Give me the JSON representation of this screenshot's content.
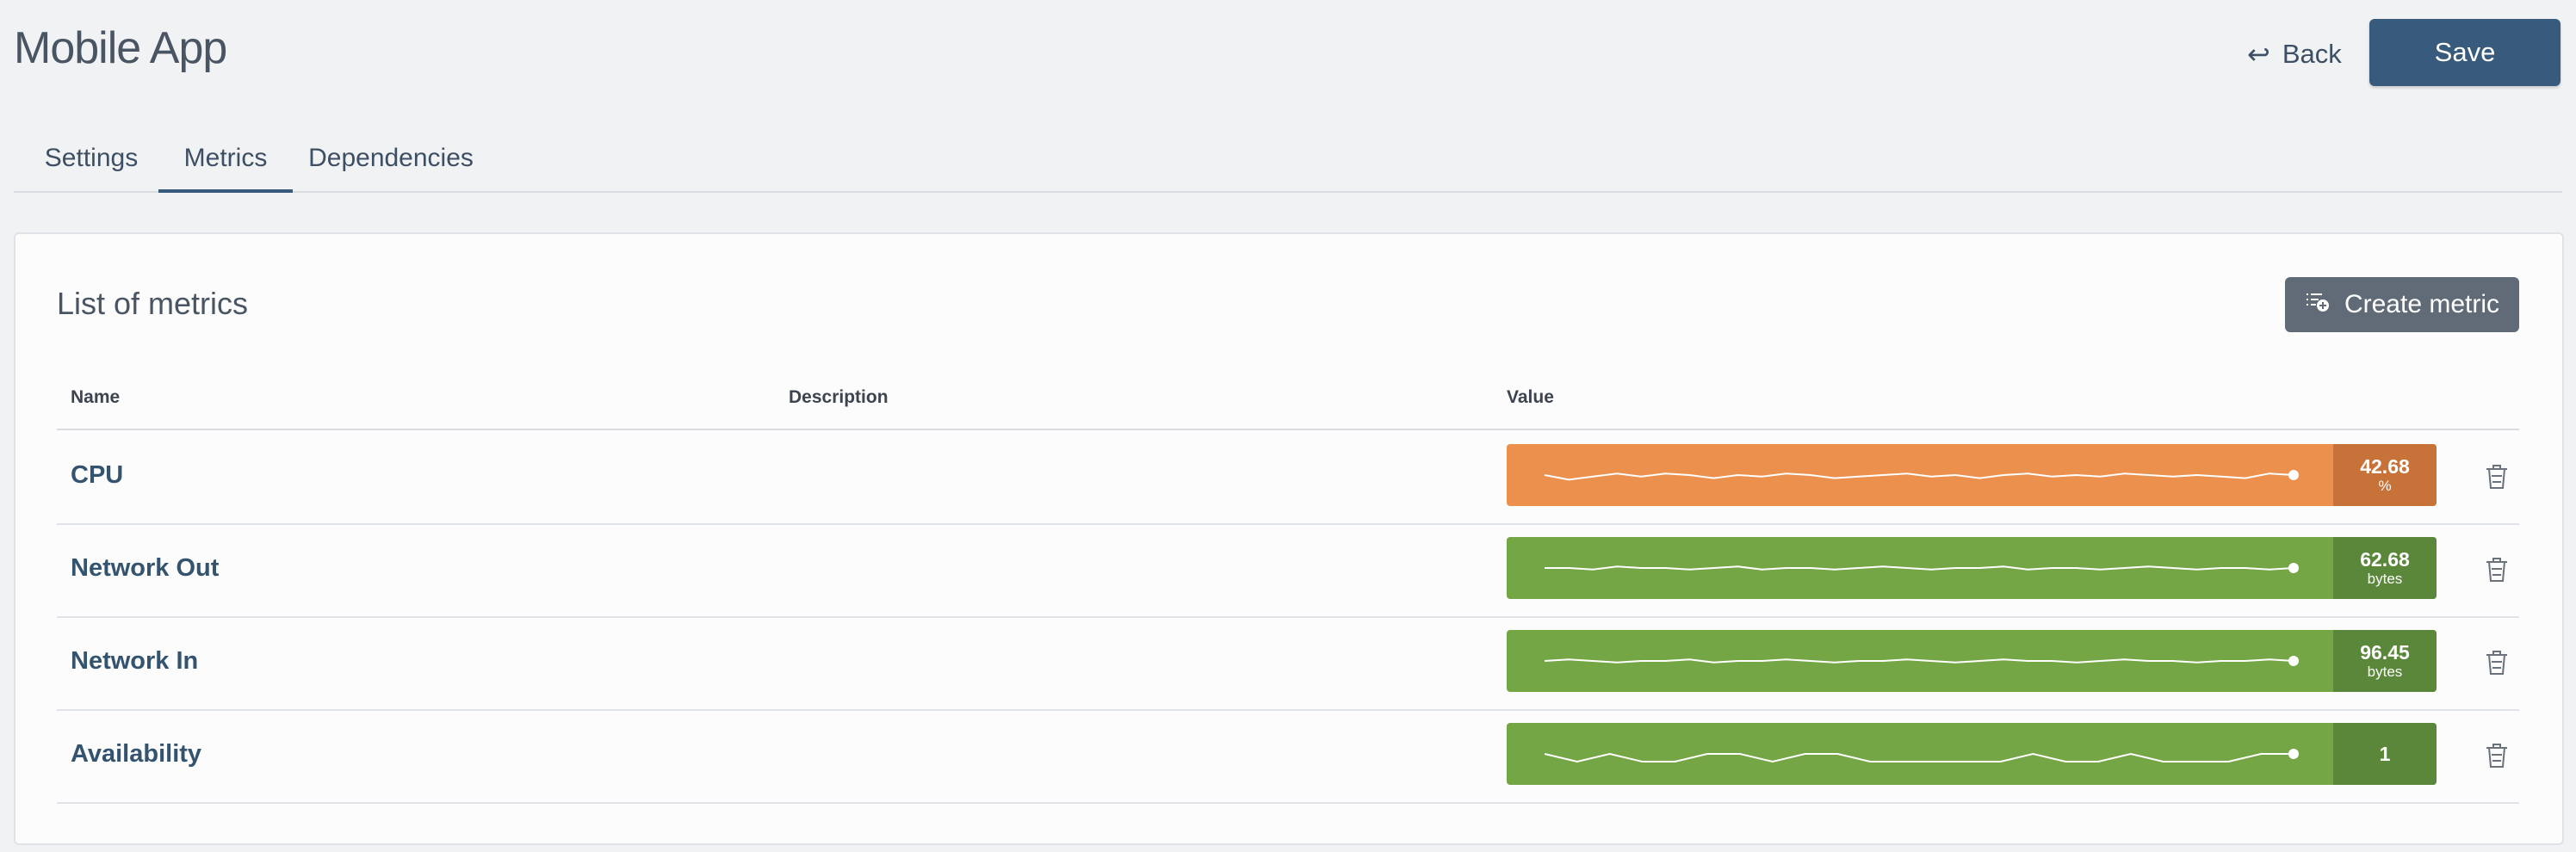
{
  "header": {
    "title": "Mobile App",
    "back_label": "Back",
    "save_label": "Save"
  },
  "tabs": [
    {
      "label": "Settings",
      "active": false
    },
    {
      "label": "Metrics",
      "active": true
    },
    {
      "label": "Dependencies",
      "active": false
    }
  ],
  "card": {
    "title": "List of metrics",
    "create_label": "Create metric"
  },
  "table": {
    "columns": [
      "Name",
      "Description",
      "Value"
    ],
    "rows": [
      {
        "name": "CPU",
        "description": "",
        "value": "42.68",
        "unit": "%",
        "status": "warning",
        "bar_color": "#eb904d",
        "value_color": "#c77238",
        "sparkline": [
          0.5,
          0.35,
          0.45,
          0.55,
          0.45,
          0.55,
          0.5,
          0.4,
          0.5,
          0.45,
          0.55,
          0.5,
          0.4,
          0.45,
          0.5,
          0.55,
          0.45,
          0.5,
          0.4,
          0.5,
          0.55,
          0.45,
          0.5,
          0.45,
          0.55,
          0.5,
          0.45,
          0.5,
          0.45,
          0.4,
          0.55,
          0.5
        ]
      },
      {
        "name": "Network Out",
        "description": "",
        "value": "62.68",
        "unit": "bytes",
        "status": "ok",
        "bar_color": "#74a646",
        "value_color": "#5a8739",
        "sparkline": [
          0.5,
          0.5,
          0.45,
          0.55,
          0.5,
          0.5,
          0.45,
          0.5,
          0.55,
          0.45,
          0.5,
          0.5,
          0.45,
          0.5,
          0.55,
          0.5,
          0.45,
          0.5,
          0.5,
          0.55,
          0.45,
          0.5,
          0.5,
          0.45,
          0.5,
          0.55,
          0.5,
          0.45,
          0.5,
          0.5,
          0.45,
          0.5
        ]
      },
      {
        "name": "Network In",
        "description": "",
        "value": "96.45",
        "unit": "bytes",
        "status": "ok",
        "bar_color": "#74a646",
        "value_color": "#5a8739",
        "sparkline": [
          0.5,
          0.55,
          0.5,
          0.45,
          0.5,
          0.5,
          0.55,
          0.45,
          0.5,
          0.5,
          0.55,
          0.5,
          0.45,
          0.5,
          0.5,
          0.55,
          0.5,
          0.45,
          0.5,
          0.55,
          0.5,
          0.5,
          0.45,
          0.5,
          0.55,
          0.5,
          0.5,
          0.45,
          0.5,
          0.5,
          0.55,
          0.5
        ]
      },
      {
        "name": "Availability",
        "description": "",
        "value": "1",
        "unit": "",
        "status": "ok",
        "bar_color": "#74a646",
        "value_color": "#5a8739",
        "sparkline": [
          0.5,
          0.25,
          0.5,
          0.25,
          0.25,
          0.5,
          0.5,
          0.25,
          0.5,
          0.5,
          0.25,
          0.25,
          0.25,
          0.25,
          0.25,
          0.5,
          0.25,
          0.25,
          0.5,
          0.25,
          0.25,
          0.25,
          0.5,
          0.5
        ]
      }
    ]
  },
  "icons": {
    "back": "back-arrow-icon",
    "create": "add-list-icon",
    "delete": "trash-icon"
  }
}
